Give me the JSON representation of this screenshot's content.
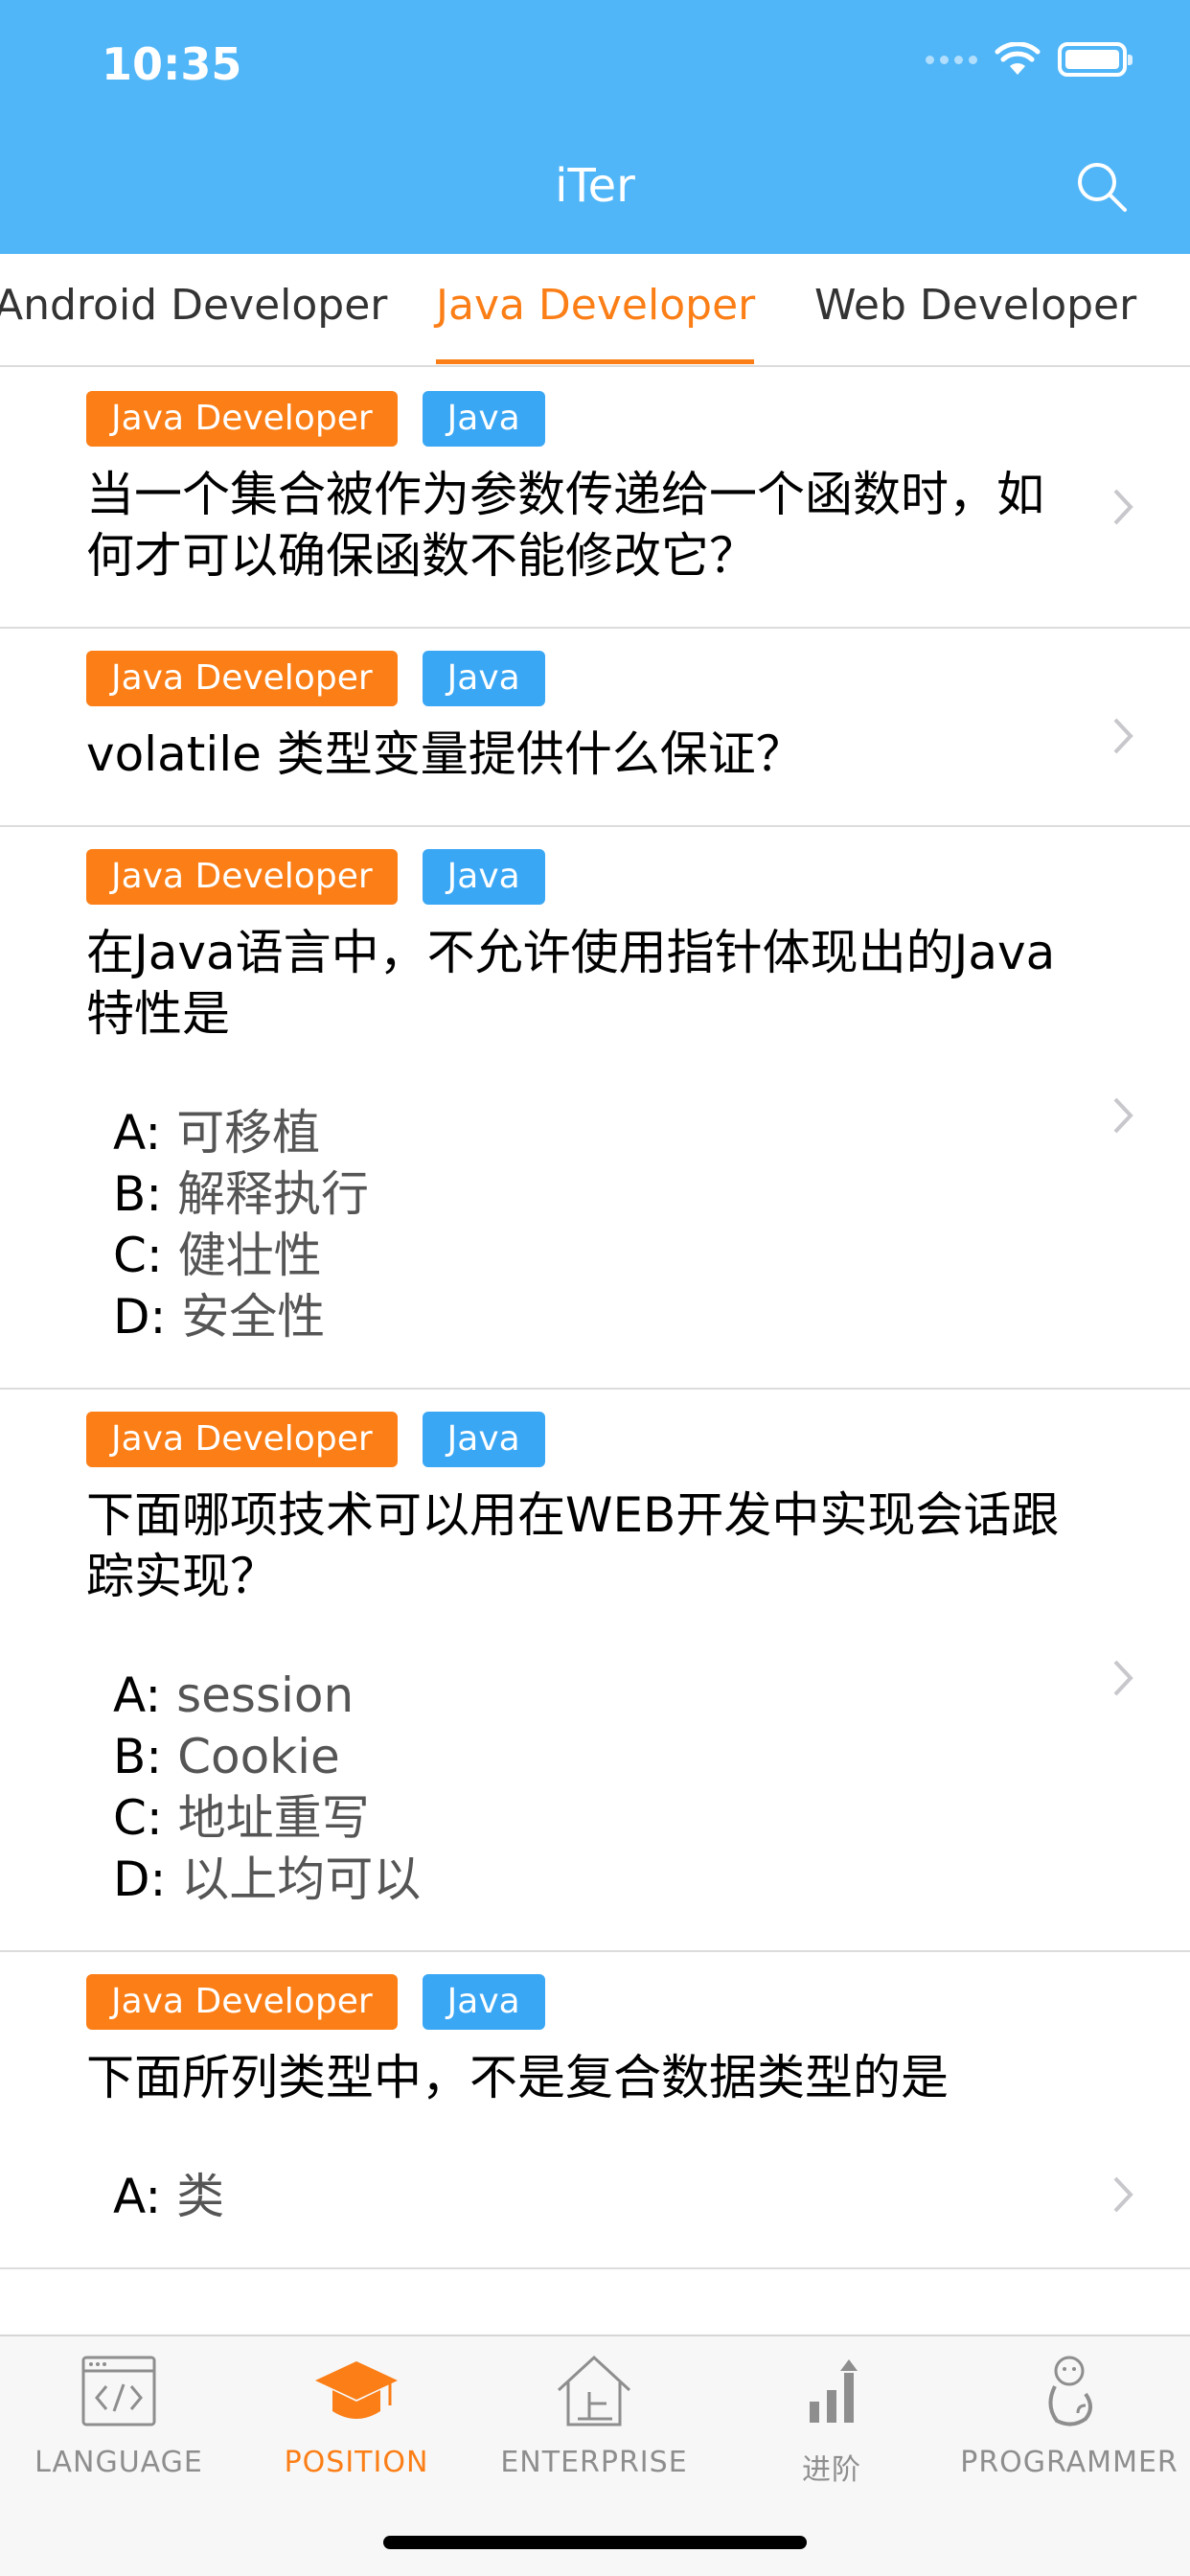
{
  "status": {
    "time": "10:35"
  },
  "header": {
    "title": "iTer"
  },
  "tabs": [
    {
      "label": "Android Developer"
    },
    {
      "label": "Java Developer"
    },
    {
      "label": "Web Developer"
    }
  ],
  "questions": [
    {
      "tags": [
        "Java Developer",
        "Java"
      ],
      "text": "当一个集合被作为参数传递给一个函数时，如何才可以确保函数不能修改它？"
    },
    {
      "tags": [
        "Java Developer",
        "Java"
      ],
      "text": "volatile 类型变量提供什么保证？"
    },
    {
      "tags": [
        "Java Developer",
        "Java"
      ],
      "text": "在Java语言中，不允许使用指针体现出的Java特性是",
      "options": [
        {
          "key": "A:",
          "value": "可移植"
        },
        {
          "key": "B:",
          "value": "解释执行"
        },
        {
          "key": "C:",
          "value": "健壮性"
        },
        {
          "key": "D:",
          "value": "安全性"
        }
      ]
    },
    {
      "tags": [
        "Java Developer",
        "Java"
      ],
      "text": "下面哪项技术可以用在WEB开发中实现会话跟踪实现？",
      "options": [
        {
          "key": "A:",
          "value": "session"
        },
        {
          "key": "B:",
          "value": "Cookie"
        },
        {
          "key": "C:",
          "value": "地址重写"
        },
        {
          "key": "D:",
          "value": "以上均可以"
        }
      ]
    },
    {
      "tags": [
        "Java Developer",
        "Java"
      ],
      "text": "下面所列类型中，不是复合数据类型的是",
      "options": [
        {
          "key": "A:",
          "value": "类"
        }
      ]
    }
  ],
  "bottom_nav": [
    {
      "label": "LANGUAGE",
      "icon": "code-window-icon"
    },
    {
      "label": "POSITION",
      "icon": "graduation-cap-icon"
    },
    {
      "label": "ENTERPRISE",
      "icon": "building-icon"
    },
    {
      "label": "进阶",
      "icon": "bar-chart-icon"
    },
    {
      "label": "PROGRAMMER",
      "icon": "monkey-icon"
    }
  ],
  "colors": {
    "header_bg": "#51b6f8",
    "accent": "#fb7e16",
    "tag_blue": "#3aa7f5"
  }
}
